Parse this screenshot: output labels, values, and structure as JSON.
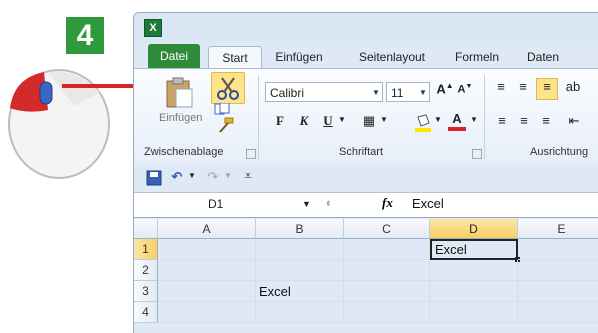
{
  "step": "4",
  "ribbon": {
    "tabs": [
      "Datei",
      "Start",
      "Einfügen",
      "Seitenlayout",
      "Formeln",
      "Daten"
    ],
    "groups": {
      "clipboard": {
        "paste_label": "Einfügen",
        "group_label": "Zwischenablage"
      },
      "font": {
        "font_name": "Calibri",
        "font_size": "11",
        "group_label": "Schriftart",
        "bold": "F",
        "italic": "K",
        "underline": "U"
      },
      "alignment": {
        "group_label": "Ausrichtung"
      }
    }
  },
  "formula_bar": {
    "name_box": "D1",
    "fx": "fx",
    "value": "Excel"
  },
  "grid": {
    "columns": [
      "A",
      "B",
      "C",
      "D",
      "E"
    ],
    "rows": [
      "1",
      "2",
      "3",
      "4"
    ],
    "cells": {
      "D1": "Excel",
      "B3": "Excel"
    },
    "active_cell": "D1"
  },
  "colors": {
    "accent_green": "#2e9a3c",
    "file_tab": "#2f8b3a",
    "highlight": "#fde38a",
    "arrow": "#d9222a"
  }
}
